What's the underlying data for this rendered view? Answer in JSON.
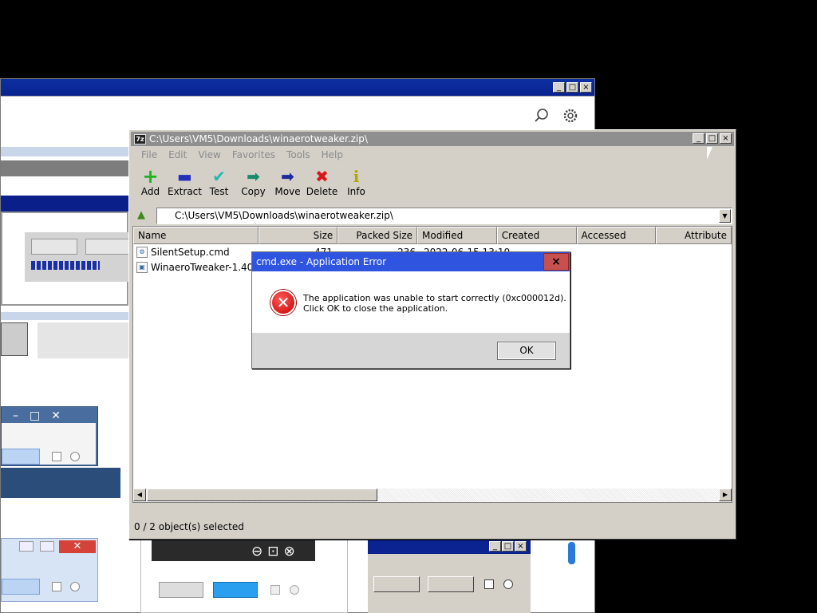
{
  "background_window": {
    "buttons": {
      "min": "_",
      "max": "□",
      "close": "×"
    },
    "icons": [
      "search-icon",
      "gear-icon"
    ],
    "thumb_windows": {
      "a": {
        "min": "–",
        "max": "□",
        "close": "✕"
      }
    }
  },
  "zip_window": {
    "title": "C:\\Users\\VM5\\Downloads\\winaerotweaker.zip\\",
    "logo": "7z",
    "title_buttons": {
      "min": "_",
      "max": "□",
      "close": "×"
    },
    "menu": [
      "File",
      "Edit",
      "View",
      "Favorites",
      "Tools",
      "Help"
    ],
    "toolbar": [
      {
        "label": "Add",
        "icon": "+",
        "color": "#22b022"
      },
      {
        "label": "Extract",
        "icon": "▬",
        "color": "#2330b8"
      },
      {
        "label": "Test",
        "icon": "✔",
        "color": "#22b6b6"
      },
      {
        "label": "Copy",
        "icon": "➡",
        "color": "#1a8a6a"
      },
      {
        "label": "Move",
        "icon": "➡",
        "color": "#1c2a9c"
      },
      {
        "label": "Delete",
        "icon": "✖",
        "color": "#d81818"
      },
      {
        "label": "Info",
        "icon": "i",
        "color": "#b8a400"
      }
    ],
    "address": "C:\\Users\\VM5\\Downloads\\winaerotweaker.zip\\",
    "columns": [
      "Name",
      "Size",
      "Packed Size",
      "Modified",
      "Created",
      "Accessed",
      "Attribute"
    ],
    "files": [
      {
        "name": "SilentSetup.cmd",
        "size": "471",
        "packed": "236",
        "modified": "2022-06-15 13:10"
      },
      {
        "name": "WinaeroTweaker-1.40.0.",
        "size": "",
        "packed": "",
        "modified": ""
      }
    ],
    "status": "0 / 2 object(s) selected"
  },
  "error_dialog": {
    "title": "cmd.exe - Application Error",
    "close": "×",
    "line1": "The application was unable to start correctly (0xc000012d).",
    "line2": "Click OK to close the application.",
    "ok": "OK",
    "icon": "error-icon"
  },
  "colors": {
    "title_active": "#2f54e0",
    "title_inactive": "#8f8f8f",
    "close_red": "#c75050"
  }
}
